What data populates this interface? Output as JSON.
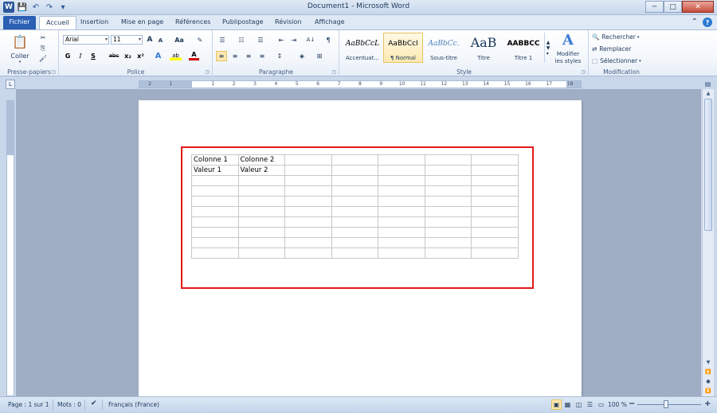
{
  "window": {
    "title": "Document1 - Microsoft Word",
    "minimize": "─",
    "maximize": "□",
    "close": "✕"
  },
  "qat": {
    "word": "W",
    "save": "💾",
    "undo": "↶",
    "redo": "↷",
    "more": "▾"
  },
  "tabs": [
    "Fichier",
    "Accueil",
    "Insertion",
    "Mise en page",
    "Références",
    "Publipostage",
    "Révision",
    "Affichage"
  ],
  "help": {
    "collapse": "⌃",
    "help": "?"
  },
  "ribbon": {
    "clipboard": {
      "label": "Presse-papiers",
      "paste": "Coller",
      "cut": "✂",
      "copy": "⎘",
      "format_painter": "🖌"
    },
    "font": {
      "label": "Police",
      "font_name": "Arial",
      "font_size": "11",
      "grow": "A",
      "shrink": "A",
      "change_case": "Aa",
      "clear": "✎",
      "bold": "G",
      "italic": "I",
      "underline": "S",
      "strike": "abc",
      "subscript": "x₂",
      "superscript": "x²",
      "effects": "A",
      "highlight": "ab",
      "color": "A"
    },
    "paragraph": {
      "label": "Paragraphe",
      "bullets": "☰",
      "numbering": "☷",
      "multilevel": "☰",
      "decrease_indent": "⇤",
      "increase_indent": "⇥",
      "sort": "A↓",
      "show_marks": "¶",
      "align_left": "≡",
      "align_center": "≡",
      "align_right": "≡",
      "justify": "≡",
      "line_spacing": "↕",
      "shading": "◈",
      "borders": "⊞"
    },
    "styles": {
      "label": "Style",
      "items": [
        {
          "sample": "AaBbCcL",
          "name": "Accentuat..."
        },
        {
          "sample": "AaBbCcI",
          "name": "¶ Normal"
        },
        {
          "sample": "AaBbCc.",
          "name": "Sous-titre"
        },
        {
          "sample": "AaB",
          "name": "Titre"
        },
        {
          "sample": "AABBCC",
          "name": "Titre 1"
        }
      ],
      "modify_label": "Modifier",
      "modify_label2": "les styles"
    },
    "editing": {
      "label": "Modification",
      "find": "Rechercher",
      "replace": "Remplacer",
      "select": "Sélectionner"
    }
  },
  "ruler": {
    "corner": "L",
    "numbers": [
      "2",
      "1",
      "",
      "1",
      "2",
      "3",
      "4",
      "5",
      "6",
      "7",
      "8",
      "9",
      "10",
      "11",
      "12",
      "13",
      "14",
      "15",
      "16",
      "17",
      "18"
    ]
  },
  "table": {
    "rows": [
      [
        "Colonne 1",
        "Colonne 2",
        "",
        "",
        "",
        "",
        ""
      ],
      [
        "Valeur 1",
        "Valeur 2",
        "",
        "",
        "",
        "",
        ""
      ],
      [
        "",
        "",
        "",
        "",
        "",
        "",
        ""
      ],
      [
        "",
        "",
        "",
        "",
        "",
        "",
        ""
      ],
      [
        "",
        "",
        "",
        "",
        "",
        "",
        ""
      ],
      [
        "",
        "",
        "",
        "",
        "",
        "",
        ""
      ],
      [
        "",
        "",
        "",
        "",
        "",
        "",
        ""
      ],
      [
        "",
        "",
        "",
        "",
        "",
        "",
        ""
      ],
      [
        "",
        "",
        "",
        "",
        "",
        "",
        ""
      ],
      [
        "",
        "",
        "",
        "",
        "",
        "",
        ""
      ]
    ]
  },
  "statusbar": {
    "page": "Page : 1 sur 1",
    "words": "Mots : 0",
    "language": "Français (France)",
    "zoom": "100 %",
    "zoom_out": "−",
    "zoom_in": "+"
  },
  "colors": {
    "highlight_border": "#e11a1a",
    "file_tab": "#2b5fb4"
  }
}
